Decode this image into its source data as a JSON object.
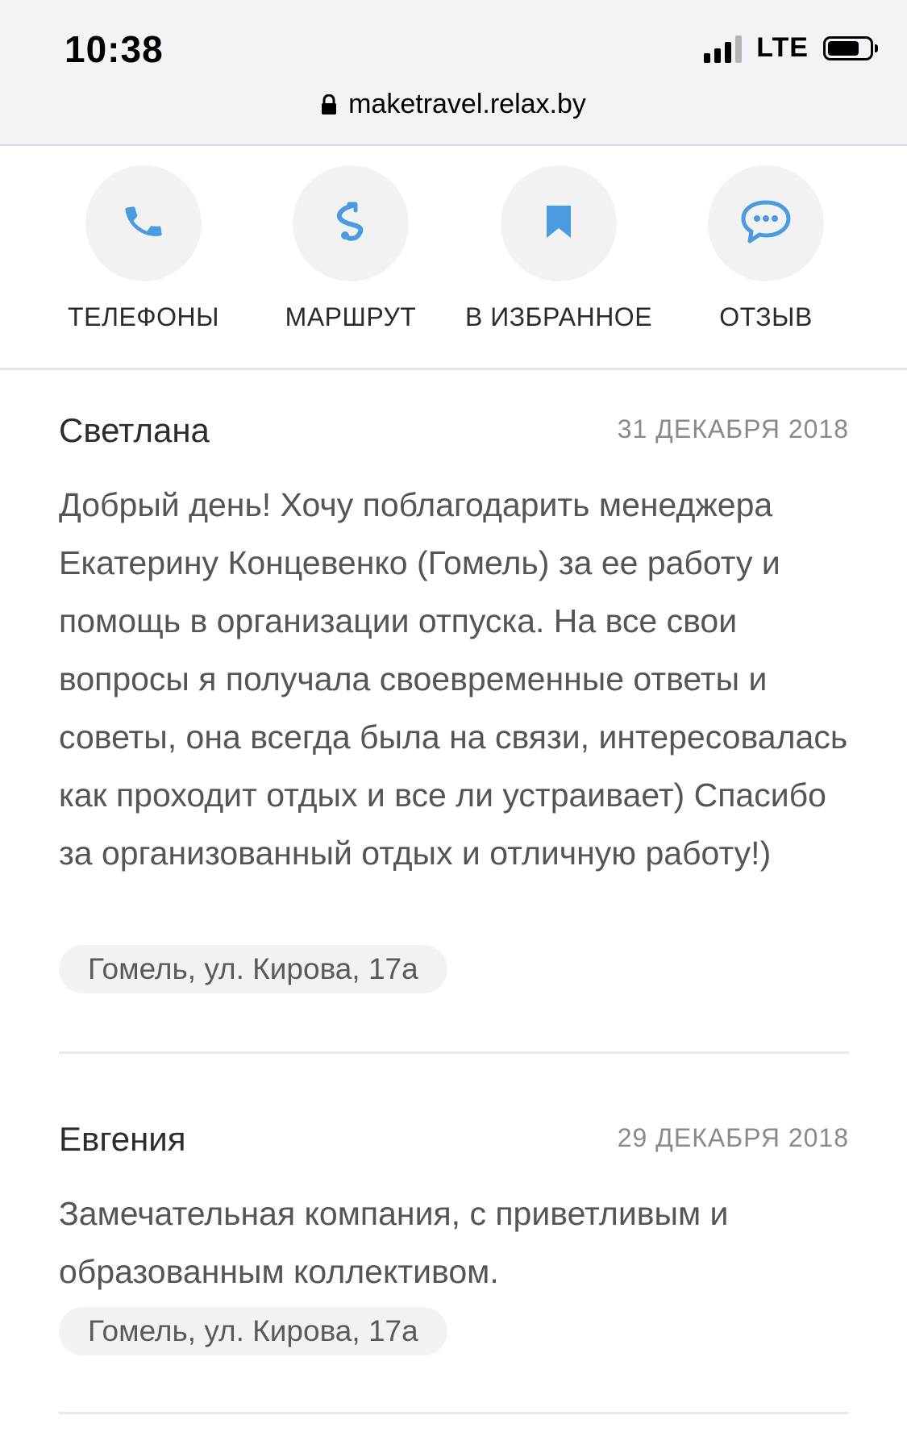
{
  "status_bar": {
    "time": "10:38",
    "network": "LTE",
    "icons": [
      "signal-bars-icon",
      "battery-icon"
    ]
  },
  "address_bar": {
    "url": "maketravel.relax.by",
    "icon": "lock-icon"
  },
  "actions": [
    {
      "label": "ТЕЛЕФОНЫ",
      "icon": "phone-icon"
    },
    {
      "label": "МАРШРУТ",
      "icon": "route-icon"
    },
    {
      "label": "В ИЗБРАННОЕ",
      "icon": "bookmark-icon"
    },
    {
      "label": "ОТЗЫВ",
      "icon": "chat-bubble-icon"
    }
  ],
  "colors": {
    "accent": "#4a9be0",
    "chip_bg": "#f2f2f3",
    "text_muted": "#555558"
  },
  "reviews": [
    {
      "author": "Светлана",
      "date": "31 ДЕКАБРЯ 2018",
      "text": "Добрый день! Хочу поблагодарить менеджера Екатерину Концевенко (Гомель) за ее работу и помощь в организации отпуска. На все свои вопросы я получала своевременные ответы и советы, она всегда была на связи, интересовалась как проходит отдых и все ли устраивает) Спасибо за организованный отдых и отличную работу!)",
      "address": "Гомель, ул. Кирова, 17а"
    },
    {
      "author": "Евгения",
      "date": "29 ДЕКАБРЯ 2018",
      "text": "Замечательная компания, с приветливым и образованным коллективом.",
      "address": "Гомель, ул. Кирова, 17а"
    }
  ]
}
